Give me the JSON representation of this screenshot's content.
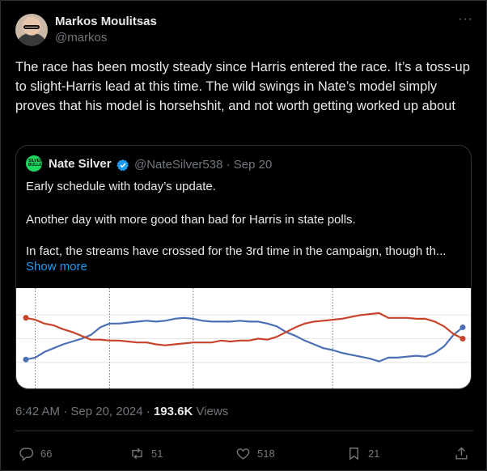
{
  "tweet": {
    "author_name": "Markos Moulitsas",
    "author_handle": "@markos",
    "more_icon": "ellipsis-icon",
    "text": "The race has been mostly steady since Harris entered the race. It’s a toss-up to slight-Harris lead at this time. The wild swings in Nate’s model simply proves that his model is horsehshit, and not worth getting worked up about",
    "time": "6:42 AM · Sep 20, 2024 · ",
    "views_count": "193.6K",
    "views_label": " Views"
  },
  "quote": {
    "avatar_text": "SILVER BULLETIN",
    "author_name": "Nate Silver",
    "verified_icon": "verified-badge-icon",
    "meta": "@NateSilver538 · Sep 20",
    "line1": "Early schedule with today’s update.",
    "line2": "Another day with more good than bad for Harris in state polls.",
    "line3": "In fact, the streams have crossed for the 3rd time in the campaign, though th...",
    "show_more": "Show more"
  },
  "actions": {
    "replies": "66",
    "reposts": "51",
    "likes": "518",
    "bookmarks": "21"
  },
  "colors": {
    "harris": "#4a6fb5",
    "trump": "#c8432b",
    "link": "#1d9bf0"
  },
  "chart_data": {
    "type": "line",
    "x": [
      0,
      1,
      2,
      3,
      4,
      5,
      6,
      7,
      8,
      9,
      10,
      11,
      12,
      13,
      14,
      15,
      16,
      17,
      18,
      19,
      20,
      21,
      22,
      23,
      24,
      25,
      26,
      27,
      28,
      29,
      30,
      31,
      32,
      33,
      34,
      35,
      36,
      37,
      38,
      39,
      40,
      41,
      42,
      43,
      44,
      45,
      46,
      47
    ],
    "series": [
      {
        "values": [
          0.28,
          0.3,
          0.36,
          0.4,
          0.44,
          0.47,
          0.5,
          0.54,
          0.62,
          0.66,
          0.66,
          0.67,
          0.68,
          0.69,
          0.68,
          0.69,
          0.71,
          0.72,
          0.71,
          0.69,
          0.68,
          0.68,
          0.68,
          0.69,
          0.68,
          0.68,
          0.66,
          0.63,
          0.57,
          0.53,
          0.48,
          0.44,
          0.4,
          0.38,
          0.35,
          0.33,
          0.31,
          0.29,
          0.26,
          0.3,
          0.3,
          0.31,
          0.32,
          0.31,
          0.35,
          0.42,
          0.54,
          0.62
        ]
      },
      {
        "values": [
          0.72,
          0.7,
          0.66,
          0.64,
          0.6,
          0.57,
          0.53,
          0.49,
          0.49,
          0.48,
          0.48,
          0.47,
          0.46,
          0.46,
          0.44,
          0.43,
          0.44,
          0.45,
          0.46,
          0.46,
          0.46,
          0.48,
          0.47,
          0.48,
          0.48,
          0.5,
          0.49,
          0.52,
          0.57,
          0.62,
          0.66,
          0.68,
          0.69,
          0.7,
          0.71,
          0.73,
          0.75,
          0.76,
          0.77,
          0.72,
          0.72,
          0.72,
          0.71,
          0.71,
          0.68,
          0.63,
          0.55,
          0.5
        ]
      }
    ],
    "vlines": [
      1,
      9,
      18,
      33
    ]
  }
}
